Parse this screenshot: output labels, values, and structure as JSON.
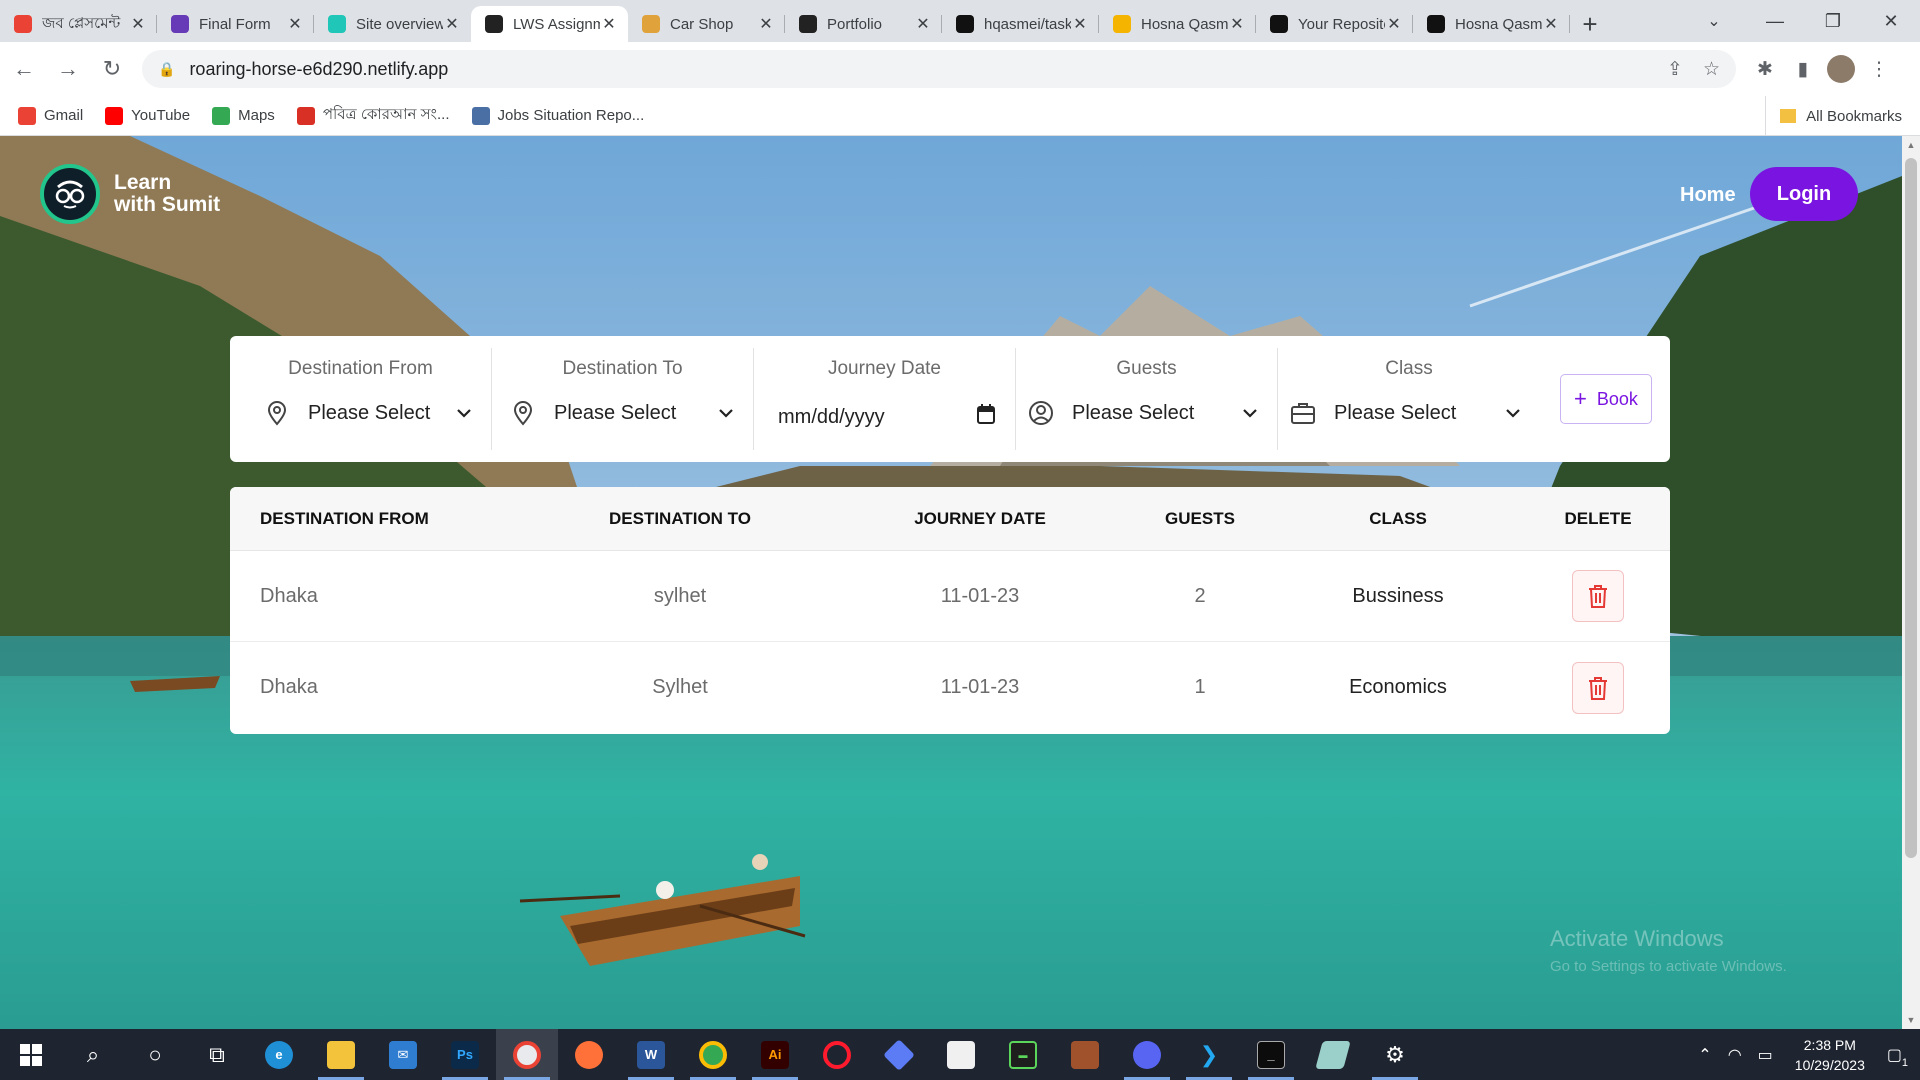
{
  "browser": {
    "tabs": [
      {
        "title": "জব প্লেসমেন্ট",
        "favicon": "gmail-icon",
        "color": "#ea4335"
      },
      {
        "title": "Final Form",
        "favicon": "forms-icon",
        "color": "#673ab7"
      },
      {
        "title": "Site overview",
        "favicon": "netlify-icon",
        "color": "#20c6b7"
      },
      {
        "title": "LWS Assignment",
        "favicon": "react-icon",
        "color": "#222222"
      },
      {
        "title": "Car Shop",
        "favicon": "car-icon",
        "color": "#e0a23b"
      },
      {
        "title": "Portfolio",
        "favicon": "react-icon",
        "color": "#222222"
      },
      {
        "title": "hqasmei/task",
        "favicon": "github-icon",
        "color": "#111111"
      },
      {
        "title": "Hosna Qasmei",
        "favicon": "hand-icon",
        "color": "#f4b400"
      },
      {
        "title": "Your Repositories",
        "favicon": "github-icon",
        "color": "#111111"
      },
      {
        "title": "Hosna Qasmei",
        "favicon": "code-icon",
        "color": "#111111"
      }
    ],
    "active_tab": 3,
    "url": "roaring-horse-e6d290.netlify.app",
    "bookmarks": [
      {
        "label": "Gmail",
        "icon": "gmail-icon"
      },
      {
        "label": "YouTube",
        "icon": "youtube-icon"
      },
      {
        "label": "Maps",
        "icon": "maps-icon"
      },
      {
        "label": "পবিত্র কোরআন সং...",
        "icon": "quran-icon"
      },
      {
        "label": "Jobs Situation Repo...",
        "icon": "moon-icon"
      }
    ],
    "all_bookmarks": "All Bookmarks"
  },
  "header": {
    "logo_line1": "Learn",
    "logo_line2": "with Sumit",
    "nav_home": "Home",
    "nav_login": "Login"
  },
  "form": {
    "from_label": "Destination From",
    "from_value": "Please Select",
    "to_label": "Destination To",
    "to_value": "Please Select",
    "date_label": "Journey Date",
    "date_placeholder": "mm/dd/yyyy",
    "guests_label": "Guests",
    "guests_value": "Please Select",
    "class_label": "Class",
    "class_value": "Please Select",
    "book_label": "Book"
  },
  "table": {
    "headers": [
      "DESTINATION FROM",
      "DESTINATION TO",
      "JOURNEY DATE",
      "GUESTS",
      "CLASS",
      "DELETE"
    ],
    "rows": [
      {
        "from": "Dhaka",
        "to": "sylhet",
        "date": "11-01-23",
        "guests": "2",
        "class": "Bussiness"
      },
      {
        "from": "Dhaka",
        "to": "Sylhet",
        "date": "11-01-23",
        "guests": "1",
        "class": "Economics"
      }
    ]
  },
  "watermark": {
    "line1": "Activate Windows",
    "line2": "Go to Settings to activate Windows."
  },
  "taskbar": {
    "time": "2:38 PM",
    "date": "10/29/2023",
    "notification_count": "1"
  },
  "colors": {
    "accent": "#7a14e0",
    "logo_ring": "#22c58b",
    "delete_red": "#e53935"
  }
}
